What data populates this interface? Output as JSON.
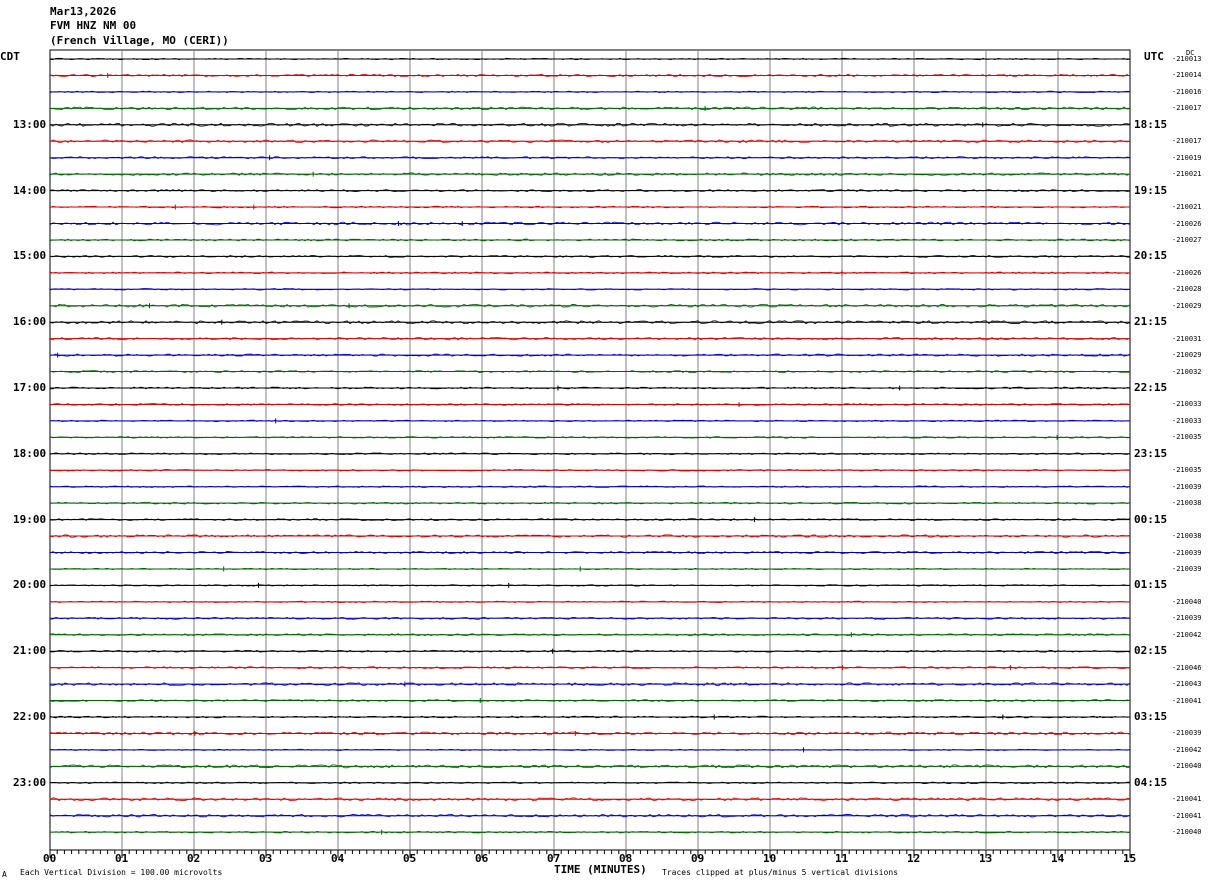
{
  "header": {
    "date": "Mar13,2026",
    "station": "FVM HNZ NM 00",
    "location": "(French Village, MO (CERI))"
  },
  "left_tz": "CDT",
  "right_tz": "UTC",
  "dc_header": "DC",
  "footer": {
    "scale_note": "Each Vertical Division =  100.00 microvolts",
    "clip_note": "Traces clipped at plus/minus 5 vertical divisions",
    "corner_mark": "A"
  },
  "colors": {
    "trace_cycle": [
      "#000000",
      "#dd0000",
      "#0000cc",
      "#006600"
    ],
    "grid": "#808080"
  },
  "chart_data": {
    "type": "line",
    "title": "",
    "xlabel": "TIME (MINUTES)",
    "xlim": [
      0,
      15
    ],
    "x_ticks": [
      "00",
      "01",
      "02",
      "03",
      "04",
      "05",
      "06",
      "07",
      "08",
      "09",
      "10",
      "11",
      "12",
      "13",
      "14",
      "15"
    ],
    "left_hour_labels": [
      "13:00",
      "14:00",
      "15:00",
      "16:00",
      "17:00",
      "18:00",
      "19:00",
      "20:00",
      "21:00",
      "22:00",
      "23:00"
    ],
    "right_hour_labels": [
      "18:15",
      "19:15",
      "20:15",
      "21:15",
      "22:15",
      "23:15",
      "00:15",
      "01:15",
      "02:15",
      "03:15",
      "04:15"
    ],
    "dc_offsets": [
      "-210013",
      "-210014",
      "-210016",
      "-210017",
      "-210017",
      "-210019",
      "-210021",
      "-210021",
      "-210026",
      "-210027",
      "-210026",
      "-210028",
      "-210029",
      "-210031",
      "-210029",
      "-210032",
      "-210033",
      "-210033",
      "-210035",
      "-210035",
      "-210039",
      "-210038",
      "-210038",
      "-210039",
      "-210039",
      "-210040",
      "-210039",
      "-210042",
      "-210046",
      "-210043",
      "-210041",
      "-210039",
      "-210042",
      "-210040",
      "-210041",
      "-210041",
      "-210040",
      "-210044",
      "-210042",
      "-210039",
      "-210039",
      "-210040",
      "-210038",
      "-210039",
      "-210039",
      "-210040"
    ],
    "trace_count": 48
  }
}
